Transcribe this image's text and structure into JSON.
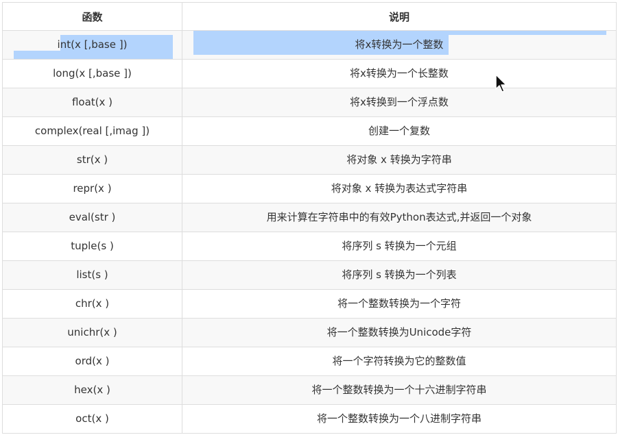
{
  "table": {
    "headers": [
      "函数",
      "说明"
    ],
    "rows": [
      {
        "func": "int(x [,base ])",
        "desc": "将x转换为一个整数",
        "selected": true
      },
      {
        "func": "long(x [,base ])",
        "desc": "将x转换为一个长整数"
      },
      {
        "func": "float(x )",
        "desc": "将x转换到一个浮点数"
      },
      {
        "func": "complex(real [,imag ])",
        "desc": "创建一个复数"
      },
      {
        "func": "str(x )",
        "desc": "将对象 x 转换为字符串"
      },
      {
        "func": "repr(x )",
        "desc": "将对象 x 转换为表达式字符串"
      },
      {
        "func": "eval(str )",
        "desc": "用来计算在字符串中的有效Python表达式,并返回一个对象"
      },
      {
        "func": "tuple(s )",
        "desc": "将序列 s 转换为一个元组"
      },
      {
        "func": "list(s )",
        "desc": "将序列 s 转换为一个列表"
      },
      {
        "func": "chr(x )",
        "desc": "将一个整数转换为一个字符"
      },
      {
        "func": "unichr(x )",
        "desc": "将一个整数转换为Unicode字符"
      },
      {
        "func": "ord(x )",
        "desc": "将一个字符转换为它的整数值"
      },
      {
        "func": "hex(x )",
        "desc": "将一个整数转换为一个十六进制字符串"
      },
      {
        "func": "oct(x )",
        "desc": "将一个整数转换为一个八进制字符串"
      }
    ]
  },
  "colors": {
    "selection": "#b3d4fd",
    "border": "#dddddd",
    "stripe": "#f8f8f8"
  },
  "icons": {
    "cursor": "mouse-pointer-icon"
  }
}
